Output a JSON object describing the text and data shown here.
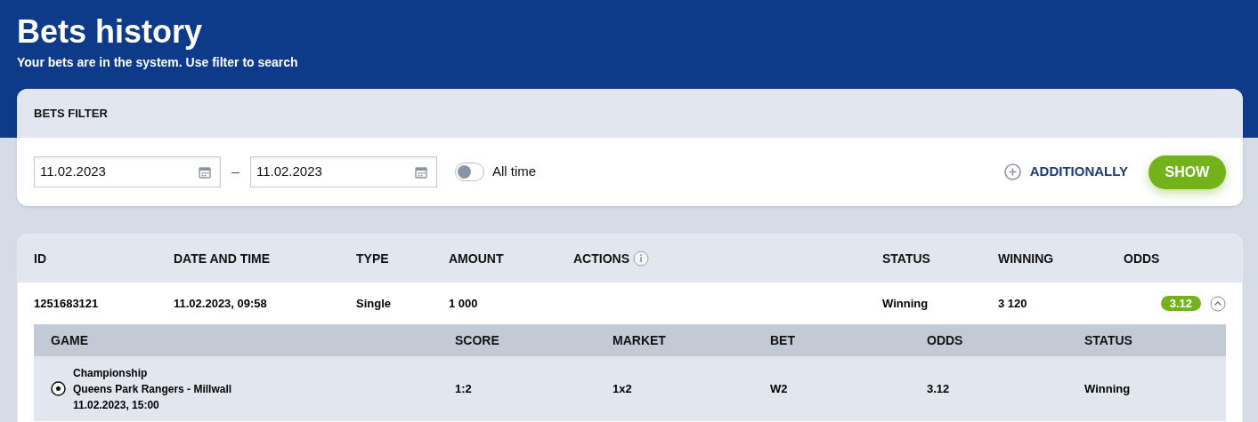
{
  "header": {
    "title": "Bets history",
    "subtitle": "Your bets are in the system. Use filter to search"
  },
  "filter": {
    "title": "BETS FILTER",
    "date_from": "11.02.2023",
    "separator": "–",
    "date_to": "11.02.2023",
    "all_time": {
      "label": "All time",
      "on": false
    },
    "additionally": "ADDITIONALLY",
    "show_button": "SHOW"
  },
  "table": {
    "columns": [
      "ID",
      "DATE AND TIME",
      "TYPE",
      "AMOUNT",
      "ACTIONS",
      "STATUS",
      "WINNING",
      "ODDS"
    ],
    "rows": [
      {
        "id": "1251683121",
        "date": "11.02.2023, 09:58",
        "type": "Single",
        "amount": "1 000",
        "status": "Winning",
        "winning": "3 120",
        "odds": "3.12",
        "expanded": true,
        "details": {
          "columns": [
            "GAME",
            "SCORE",
            "MARKET",
            "BET",
            "ODDS",
            "STATUS"
          ],
          "rows": [
            {
              "league": "Championship",
              "match": "Queens Park Rangers - Millwall",
              "time": "11.02.2023, 15:00",
              "score": "1:2",
              "market": "1x2",
              "bet": "W2",
              "odds": "3.12",
              "status": "Winning"
            }
          ]
        }
      }
    ]
  }
}
